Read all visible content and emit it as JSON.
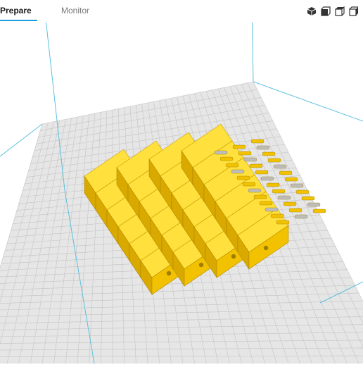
{
  "tabs": {
    "prepare": "Prepare",
    "monitor": "Monitor"
  },
  "view_buttons": [
    "3d-view-icon",
    "front-view-icon",
    "top-view-icon",
    "side-view-icon"
  ],
  "colors": {
    "accent": "#1aa0dd",
    "build_plate": "#e6e6e6",
    "grid_line": "#c4c4c4",
    "model": "#f2c200",
    "model_support": "#bdbdbd"
  }
}
